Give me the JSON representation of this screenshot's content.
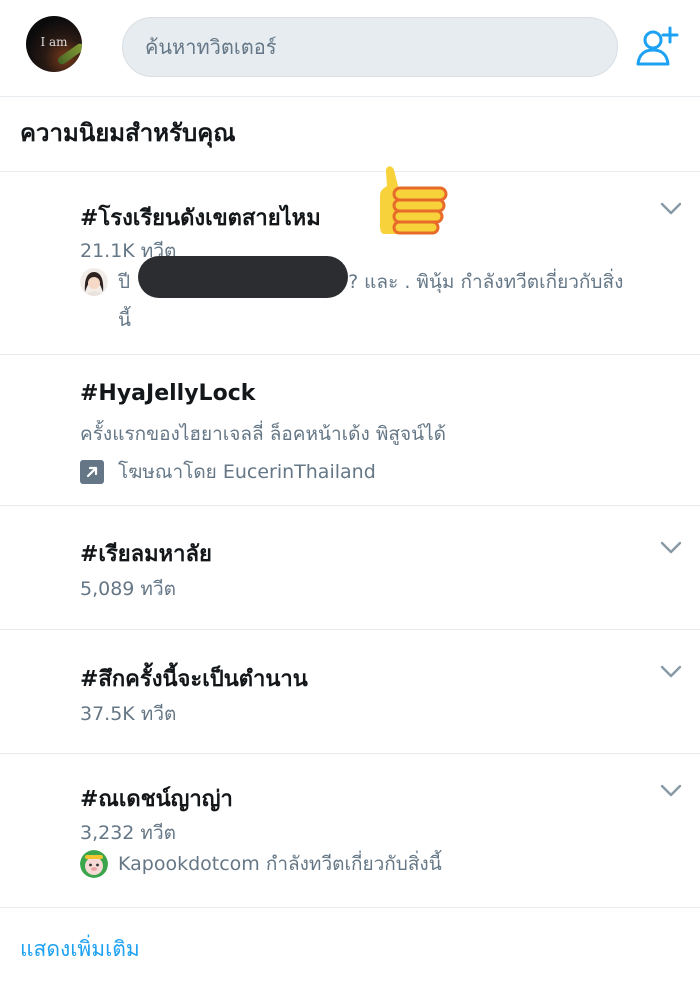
{
  "header": {
    "avatar_text": "I am",
    "search_placeholder": "ค้นหาทวิตเตอร์"
  },
  "section": {
    "title": "ความนิยมสำหรับคุณ"
  },
  "trends": [
    {
      "name": "#โรงเรียนดังเขตสายไหม",
      "count": "21.1K ทวีต",
      "context_start": "ปี",
      "context_end": "? และ . พินุ้ม กำลังทวีตเกี่ยวกับสิ่ง",
      "context_wrap": "นี้"
    },
    {
      "name": "#HyaJellyLock",
      "description": "ครั้งแรกของไฮยาเจลลี่ ล็อคหน้าเด้ง พิสูจน์ได้",
      "promoted": "โฆษณาโดย EucerinThailand"
    },
    {
      "name": "#เรียลมหาลัย",
      "count": "5,089 ทวีต"
    },
    {
      "name": "#สึกครั้งนี้จะเป็นตำนาน",
      "count": "37.5K ทวีต"
    },
    {
      "name": "#ณเดชน์ญาญ่า",
      "count": "3,232 ทวีต",
      "context": "Kapookdotcom กำลังทวีตเกี่ยวกับสิ่งนี้"
    }
  ],
  "footer": {
    "show_more": "แสดงเพิ่มเติม"
  },
  "colors": {
    "accent": "#1da1f2",
    "text_primary": "#14171a",
    "text_secondary": "#657786",
    "divider": "#e6ecf0",
    "search_bg": "#e6ecf0"
  }
}
